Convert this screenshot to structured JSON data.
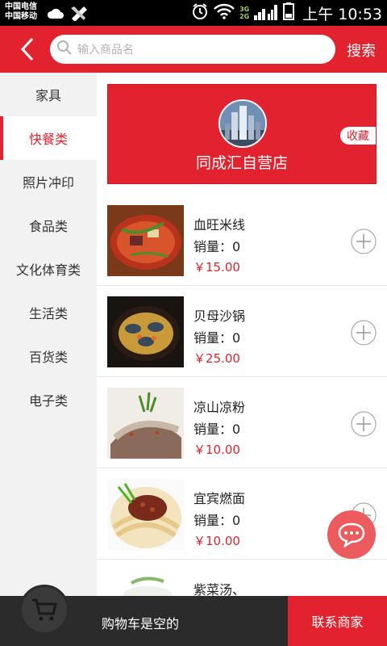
{
  "status_bar": {
    "carrier1": "中国电信",
    "carrier2": "中国移动",
    "net1": "3G",
    "net2": "2G",
    "time": "上午 10:53"
  },
  "header": {
    "search_placeholder": "输入商品名",
    "search_label": "搜索"
  },
  "sidebar": {
    "items": [
      {
        "label": "家具"
      },
      {
        "label": "快餐类"
      },
      {
        "label": "照片冲印"
      },
      {
        "label": "食品类"
      },
      {
        "label": "文化体育类"
      },
      {
        "label": "生活类"
      },
      {
        "label": "百货类"
      },
      {
        "label": "电子类"
      }
    ],
    "active_index": 1
  },
  "store": {
    "name": "同成汇自营店",
    "favorite_label": "收藏"
  },
  "products": [
    {
      "name": "血旺米线",
      "sales": "销量：0",
      "price": "￥15.00"
    },
    {
      "name": "贝母沙锅",
      "sales": "销量：0",
      "price": "￥25.00"
    },
    {
      "name": "凉山凉粉",
      "sales": "销量：0",
      "price": "￥10.00"
    },
    {
      "name": "宜宾燃面",
      "sales": "销量：0",
      "price": "￥10.00"
    },
    {
      "name": "紫菜汤、",
      "sales": "",
      "price": ""
    }
  ],
  "bottom": {
    "cart_status": "购物车是空的",
    "contact_label": "联系商家"
  },
  "colors": {
    "accent": "#e2232f",
    "bottom_bar": "#2b2b2b",
    "chat_fab": "#ec5b5d"
  }
}
